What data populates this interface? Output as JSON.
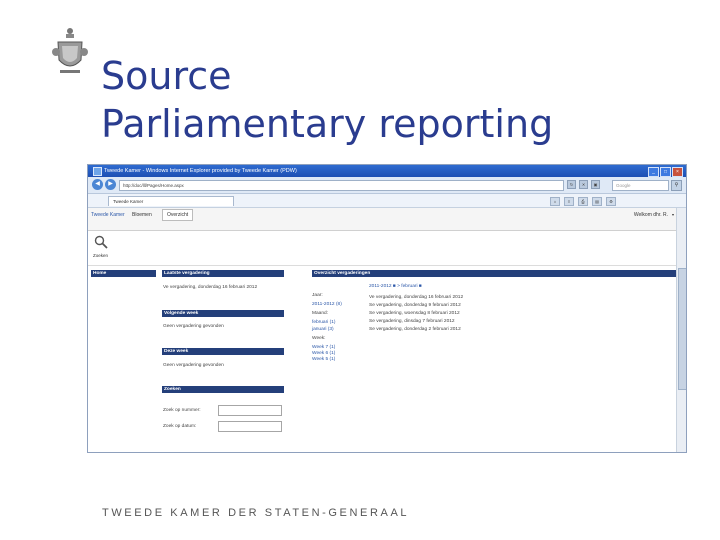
{
  "slide": {
    "title_line1": "Source",
    "title_line2": "Parliamentary reporting",
    "footer": "TWEEDE KAMER DER STATEN-GENERAAL"
  },
  "browser": {
    "window_title": "Tweede Kamer - Windows Internet Explorer provided by Tweede Kamer (PDW)",
    "address": "http://doc/lll/Pages/Home.aspx",
    "tab_label": "Tweede Kamer",
    "search_placeholder": "Google",
    "win_min": "_",
    "win_max": "□",
    "win_close": "×",
    "back": "◀",
    "forward": "▶",
    "search_go": "⚲"
  },
  "app": {
    "breadcrumb": "Tweede Kamer",
    "nav_item": "Bloemen",
    "nav_selected": "Overzicht",
    "user": "Welkom dhr. R.",
    "search_label": "Zoeken",
    "left_menu_title": "Home",
    "sections": {
      "latest_title": "Laatste vergadering",
      "latest_item": "Ve vergadering, donderdag 16 februari 2012",
      "next_week_title": "Volgende week",
      "next_week_item": "Geen vergadering gevonden",
      "this_week_title": "Deze week",
      "this_week_item": "Geen vergadering gevonden",
      "search_title": "Zoeken",
      "search_number_label": "Zoek op nummer:",
      "search_date_label": "Zoek op datum:"
    },
    "overview": {
      "title": "Overzicht vergaderingen",
      "nav": "2011-2012  ■  > februari  ■",
      "filters": [
        {
          "label": "Jaar:",
          "value": ""
        },
        {
          "label": "2011-2012",
          "value": "(8)"
        },
        {
          "label": "Maand:",
          "value": ""
        },
        {
          "label": "februari",
          "value": "(1)"
        },
        {
          "label": "januari",
          "value": "(3)"
        },
        {
          "label": "Week:",
          "value": ""
        },
        {
          "label": "Week 7",
          "value": "(1)"
        },
        {
          "label": "Week 6",
          "value": "(1)"
        },
        {
          "label": "Week 5",
          "value": "(1)"
        }
      ],
      "meetings": [
        "Ve vergadering, donderdag 16 februari 2012",
        "Se vergadering, donderdag 9 februari 2012",
        "Se vergadering, woensdag 8 februari 2012",
        "Se vergadering, dinsdag 7 februari 2012",
        "Se vergadering, donderdag 2 februari 2012"
      ]
    }
  },
  "colors": {
    "title": "#2a3c8f",
    "section_header": "#243f7a",
    "link": "#2b57a8"
  }
}
